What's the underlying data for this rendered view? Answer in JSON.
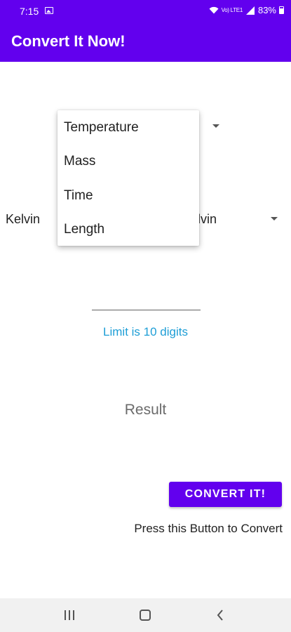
{
  "status_bar": {
    "time": "7:15",
    "signal_label": "Vo) LTE1",
    "battery_percent": "83%",
    "icons": [
      "image-icon",
      "wifi-icon",
      "signal-icon",
      "battery-icon"
    ]
  },
  "app_bar": {
    "title": "Convert It Now!"
  },
  "from_unit": {
    "selected": "Kelvin"
  },
  "to_unit": {
    "selected_visible": "lvin"
  },
  "category_dropdown": {
    "items": [
      "Temperature",
      "Mass",
      "Time",
      "Length"
    ]
  },
  "value_input": {
    "value": "",
    "hint": "Limit is 10 digits"
  },
  "result": {
    "text": "Result"
  },
  "convert": {
    "button_label": "CONVERT IT!",
    "caption": "Press this Button to Convert"
  },
  "colors": {
    "primary": "#6200ee",
    "hint": "#1e9ed6",
    "nav_bg": "#f1f1f1"
  }
}
